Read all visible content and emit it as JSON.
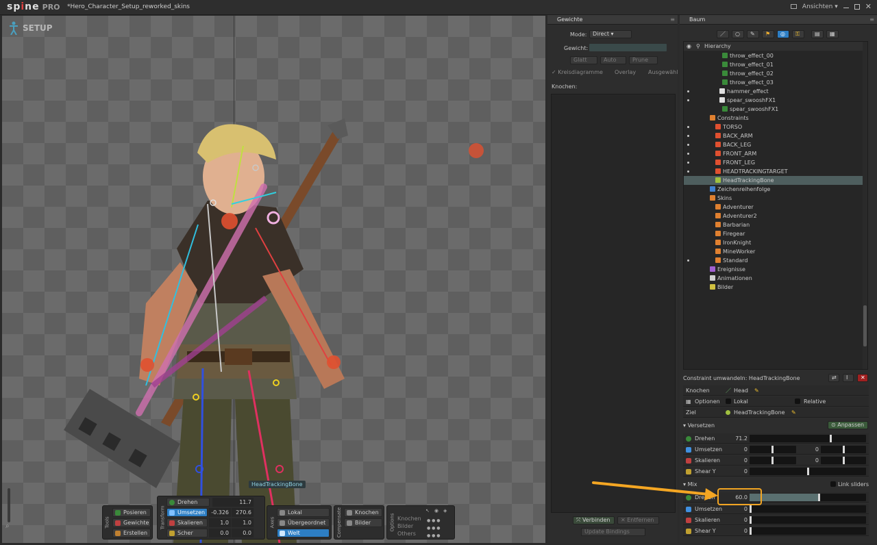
{
  "app": {
    "logo": "sp",
    "logo_dot": "i",
    "logo_rest": "ne",
    "edition": "PRO",
    "filename": "*Hero_Character_Setup_reworked_skins",
    "views_label": "Ansichten"
  },
  "viewport": {
    "mode_label": "SETUP",
    "hover_tag": "HeadTrackingBone"
  },
  "tools": {
    "section_label": "Tools",
    "pose": "Posieren",
    "weights": "Gewichte",
    "create": "Erstellen"
  },
  "transform": {
    "section_label": "Transform",
    "rotate": {
      "label": "Drehen",
      "v1": "11.7"
    },
    "translate": {
      "label": "Umsetzen",
      "v1": "-0.326",
      "v2": "270.6"
    },
    "scale": {
      "label": "Skalieren",
      "v1": "1.0",
      "v2": "1.0"
    },
    "shear": {
      "label": "Scher",
      "v1": "0.0",
      "v2": "0.0"
    }
  },
  "axes": {
    "section_label": "Axes",
    "local": "Lokal",
    "parent": "Übergeordnet",
    "world": "Welt"
  },
  "compensate": {
    "section_label": "Compensate",
    "bones": "Knochen",
    "images": "Bilder"
  },
  "options": {
    "section_label": "Options",
    "rows": [
      "Knochen",
      "Bilder",
      "Others"
    ]
  },
  "weights_panel": {
    "title": "Gewichte",
    "mode_label": "Mode:",
    "mode_value": "Direct",
    "weight_label": "Gewicht:",
    "smooth": "Glatt",
    "auto": "Auto",
    "prune": "Prune",
    "pie": "Kreisdiagramme",
    "overlay": "Overlay",
    "selected": "Ausgewählt",
    "bones_label": "Knochen:",
    "bind": "Verbinden",
    "remove": "Entfernen",
    "update": "Update Bindings"
  },
  "tree_panel": {
    "title": "Baum",
    "hierarchy_label": "Hierarchy",
    "rows": [
      {
        "label": "throw_effect_00",
        "indent": 56,
        "icon": "#3a8a3a",
        "eye": false
      },
      {
        "label": "throw_effect_01",
        "indent": 56,
        "icon": "#3a8a3a",
        "eye": false
      },
      {
        "label": "throw_effect_02",
        "indent": 56,
        "icon": "#3a8a3a",
        "eye": false
      },
      {
        "label": "throw_effect_03",
        "indent": 56,
        "icon": "#3a8a3a",
        "eye": false
      },
      {
        "label": "hammer_effect",
        "indent": 52,
        "icon": "#e0e0e0",
        "eye": true
      },
      {
        "label": "spear_swooshFX1",
        "indent": 52,
        "icon": "#e0e0e0",
        "eye": true
      },
      {
        "label": "spear_swooshFX1",
        "indent": 56,
        "icon": "#3a8a3a",
        "eye": false
      },
      {
        "label": "Constraints",
        "indent": 38,
        "icon": "#e08030",
        "eye": false
      },
      {
        "label": "TORSO",
        "indent": 46,
        "icon": "#e05030",
        "eye": true
      },
      {
        "label": "BACK_ARM",
        "indent": 46,
        "icon": "#e05030",
        "eye": true
      },
      {
        "label": "BACK_LEG",
        "indent": 46,
        "icon": "#e05030",
        "eye": true
      },
      {
        "label": "FRONT_ARM",
        "indent": 46,
        "icon": "#e05030",
        "eye": true
      },
      {
        "label": "FRONT_LEG",
        "indent": 46,
        "icon": "#e05030",
        "eye": true
      },
      {
        "label": "HEADTRACKINGTARGET",
        "indent": 46,
        "icon": "#e05030",
        "eye": true
      },
      {
        "label": "HeadTrackingBone",
        "indent": 46,
        "icon": "#a0c040",
        "eye": false,
        "selected": true
      },
      {
        "label": "Zeichenreihenfolge",
        "indent": 38,
        "icon": "#4080d0",
        "eye": false
      },
      {
        "label": "Skins",
        "indent": 38,
        "icon": "#e08030",
        "eye": false
      },
      {
        "label": "Adventurer",
        "indent": 46,
        "icon": "#e08030",
        "eye": false
      },
      {
        "label": "Adventurer2",
        "indent": 46,
        "icon": "#e08030",
        "eye": false
      },
      {
        "label": "Barbarian",
        "indent": 46,
        "icon": "#e08030",
        "eye": false
      },
      {
        "label": "Firegear",
        "indent": 46,
        "icon": "#e08030",
        "eye": false
      },
      {
        "label": "IronKnight",
        "indent": 46,
        "icon": "#e08030",
        "eye": false
      },
      {
        "label": "MineWorker",
        "indent": 46,
        "icon": "#e08030",
        "eye": false
      },
      {
        "label": "Standard",
        "indent": 46,
        "icon": "#e08030",
        "eye": true
      },
      {
        "label": "Ereignisse",
        "indent": 38,
        "icon": "#a060d0",
        "eye": false
      },
      {
        "label": "Animationen",
        "indent": 38,
        "icon": "#d0d0d0",
        "eye": false
      },
      {
        "label": "Bilder",
        "indent": 38,
        "icon": "#d0c040",
        "eye": false
      }
    ],
    "convert_label": "Constraint umwandeln: HeadTrackingBone",
    "bone_row_label": "Knochen",
    "bone_value": "Head",
    "options_row_label": "Optionen",
    "opt_local": "Lokal",
    "opt_relative": "Relative",
    "target_row_label": "Ziel",
    "target_value": "HeadTrackingBone",
    "offset_section": "Versetzen",
    "adjust_btn": "Anpassen",
    "offset_rotate": {
      "label": "Drehen",
      "v": "71.2",
      "level": 0.7
    },
    "offset_translate": {
      "label": "Umsetzen",
      "v1": "0",
      "v2": "0"
    },
    "offset_scale": {
      "label": "Skalieren",
      "v1": "0",
      "v2": "0"
    },
    "offset_shear": {
      "label": "Shear Y",
      "v": "0",
      "level": 0.5
    },
    "mix_section": "Mix",
    "link_sliders": "Link sliders",
    "mix_rotate": {
      "label": "Drehen",
      "v": "60.0",
      "level": 0.6
    },
    "mix_translate": {
      "label": "Umsetzen",
      "v": "0"
    },
    "mix_scale": {
      "label": "Skalieren",
      "v": "0"
    },
    "mix_shear": {
      "label": "Shear Y",
      "v": "0"
    }
  },
  "colors": {
    "accent_blue": "#2d7ec4",
    "highlight_orange": "#f4a623",
    "selected_row": "#4e5e5e"
  }
}
